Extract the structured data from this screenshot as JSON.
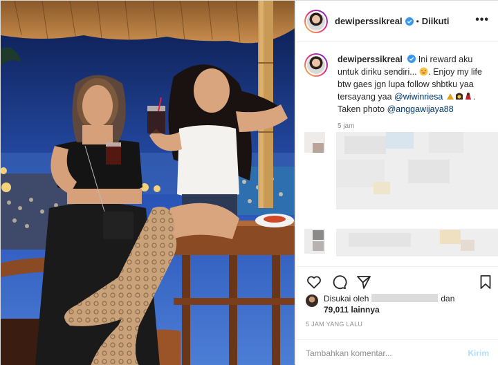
{
  "post": {
    "username": "dewiperssikreal",
    "separator": "•",
    "follow_status": "Diikuti",
    "more": "•••",
    "caption_line1": "Ini reward aku untuk diriku sendiri...",
    "caption_line2": ". Enjoy my life btw gaes jgn lupa follow shbtku yaa tersayang yaa",
    "mention1": "@wiwinriesa",
    "caption_line3": ". Taken photo",
    "mention2": "@anggawijaya88",
    "caption_time": "5 jam"
  },
  "likes": {
    "prefix": "Disukai oleh",
    "and": "dan",
    "count": "79,011 lainnya"
  },
  "timestamp": "5 JAM YANG LALU",
  "comment": {
    "placeholder": "Tambahkan komentar...",
    "send_label": "Kirim"
  },
  "icons": {
    "like": "heart-icon",
    "comment": "comment-icon",
    "share": "share-icon",
    "save": "bookmark-icon",
    "verified": "verified-badge-icon"
  },
  "colors": {
    "verified": "#3897f0",
    "mention": "#00376b",
    "send_disabled": "#b2dffc",
    "muted": "#8e8e8e"
  }
}
